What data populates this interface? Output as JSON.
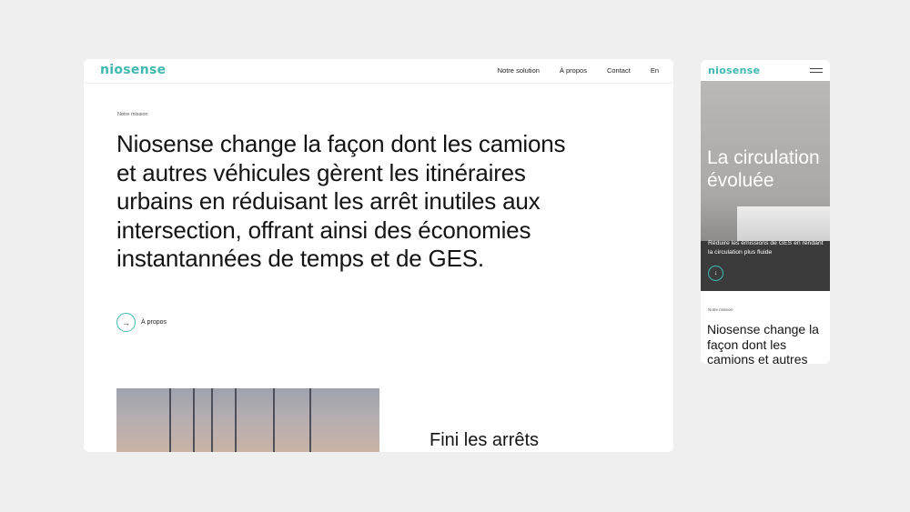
{
  "desktop": {
    "logo": "niosense",
    "nav": [
      "Notre solution",
      "À propos",
      "Contact",
      "En"
    ],
    "eyebrow": "Notre mission",
    "headline": "Niosense change la façon dont les camions et autres véhicules gèrent les itinéraires urbains en réduisant les arrêt inutiles aux intersection, offrant ainsi des économies instantannées de temps et de GES.",
    "cta_label": "À propos",
    "cta_icon": "arrow-right-icon",
    "subheading": "Fini les arrêts"
  },
  "mobile": {
    "logo": "niosense",
    "hero_title": "La circulation évoluée",
    "hero_desc": "Réduire les émissions de GES en rendant la circulation plus fluide",
    "hero_icon": "arrow-down-icon",
    "eyebrow": "Notre mission",
    "headline": "Niosense change la façon dont les camions et autres"
  },
  "colors": {
    "accent": "#3fb8b2",
    "background": "#efefef"
  }
}
